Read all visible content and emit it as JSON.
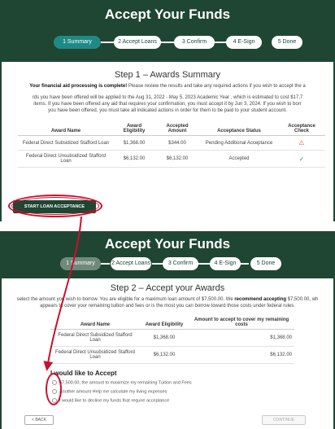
{
  "header": {
    "title": "Accept Your Funds"
  },
  "steps": [
    {
      "label": "1 Summary"
    },
    {
      "label": "2 Accept Loans"
    },
    {
      "label": "3 Confirm"
    },
    {
      "label": "4 E-Sign"
    },
    {
      "label": "5 Done"
    }
  ],
  "summary": {
    "heading": "Step 1 – Awards Summary",
    "intro_bold": "Your financial aid processing is complete!",
    "intro_rest": " Please review the results and take any required actions if you wish to accept the a",
    "line2": "rds you have been offered will be applied to the Aug 31, 2022 - May 5, 2023 Academic Year , which is estimated to cost $17,7",
    "line3": "items. If you have been offered any aid that requires your confirmation, you must accept it by Jun 3, 2024. If you wish to borr",
    "line4": "you have been offered, you must take all indicated actions in order for them to be paid to your student account.",
    "table": {
      "headers": [
        "Award Name",
        "Award Eligibility",
        "Accepted Amount",
        "Acceptance Status",
        "Acceptance Check"
      ],
      "rows": [
        {
          "name": "Federal Direct Subsidized Stafford Loan",
          "eligibility": "$1,368.00",
          "accepted": "$344.00",
          "status": "Pending Additional Acceptance",
          "check": "warning-icon"
        },
        {
          "name": "Federal Direct Unsubsidized Stafford Loan",
          "eligibility": "$6,132.00",
          "accepted": "$6,132.00",
          "status": "Accepted",
          "check": "check-circle-icon"
        }
      ]
    },
    "start_button": "START LOAN ACCEPTANCE"
  },
  "accept": {
    "heading": "Step 2 – Accept your Awards",
    "line1": "select the amount you wish to borrow. You are eligible for a maximum loan amount of $7,500.00. We ",
    "line1_bold": "recommend accepting",
    "line1_end": " $7,500.00, wh",
    "line2": "appears to cover your remaining tuition and fees or is the most you can borrow toward those costs under federal rules.",
    "table": {
      "headers": [
        "Award Name",
        "Award Eligibility",
        "Amount to accept to cover my remaining costs"
      ],
      "rows": [
        {
          "name": "Federal Direct Subsidized Stafford Loan",
          "eligibility": "$1,368.00",
          "amount": "$1,368.00"
        },
        {
          "name": "Federal Direct Unsubsidized Stafford Loan",
          "eligibility": "$6,132.00",
          "amount": "$6,132.00"
        }
      ]
    },
    "options_title": "I would like to Accept",
    "options": [
      "$7,500.00, the amount to maximize my remaining Tuition and Fees",
      "Another amount   Help me calculate my living expenses",
      "I would like to decline my funds that require acceptance"
    ],
    "back_button": "< BACK",
    "continue_button": "CONTINUE"
  },
  "colors": {
    "header": "#1f4632",
    "accent": "#1f8a85",
    "annotation": "#c8102e"
  }
}
